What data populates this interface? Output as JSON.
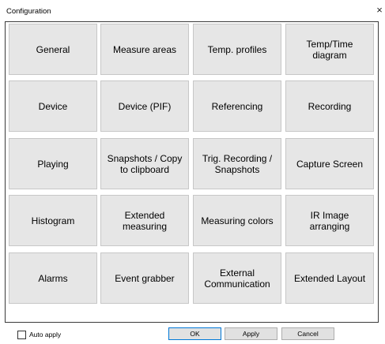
{
  "window": {
    "title": "Configuration",
    "close_glyph": "×"
  },
  "tiles": [
    "General",
    "Measure areas",
    "Temp. profiles",
    "Temp/Time diagram",
    "Device",
    "Device (PIF)",
    "Referencing",
    "Recording",
    "Playing",
    "Snapshots / Copy to clipboard",
    "Trig. Recording / Snapshots",
    "Capture Screen",
    "Histogram",
    "Extended measuring",
    "Measuring colors",
    "IR Image arranging",
    "Alarms",
    "Event grabber",
    "External Communication",
    "Extended Layout"
  ],
  "footer": {
    "auto_apply_label": "Auto apply",
    "auto_apply_checked": false,
    "ok_label": "OK",
    "apply_label": "Apply",
    "cancel_label": "Cancel"
  }
}
